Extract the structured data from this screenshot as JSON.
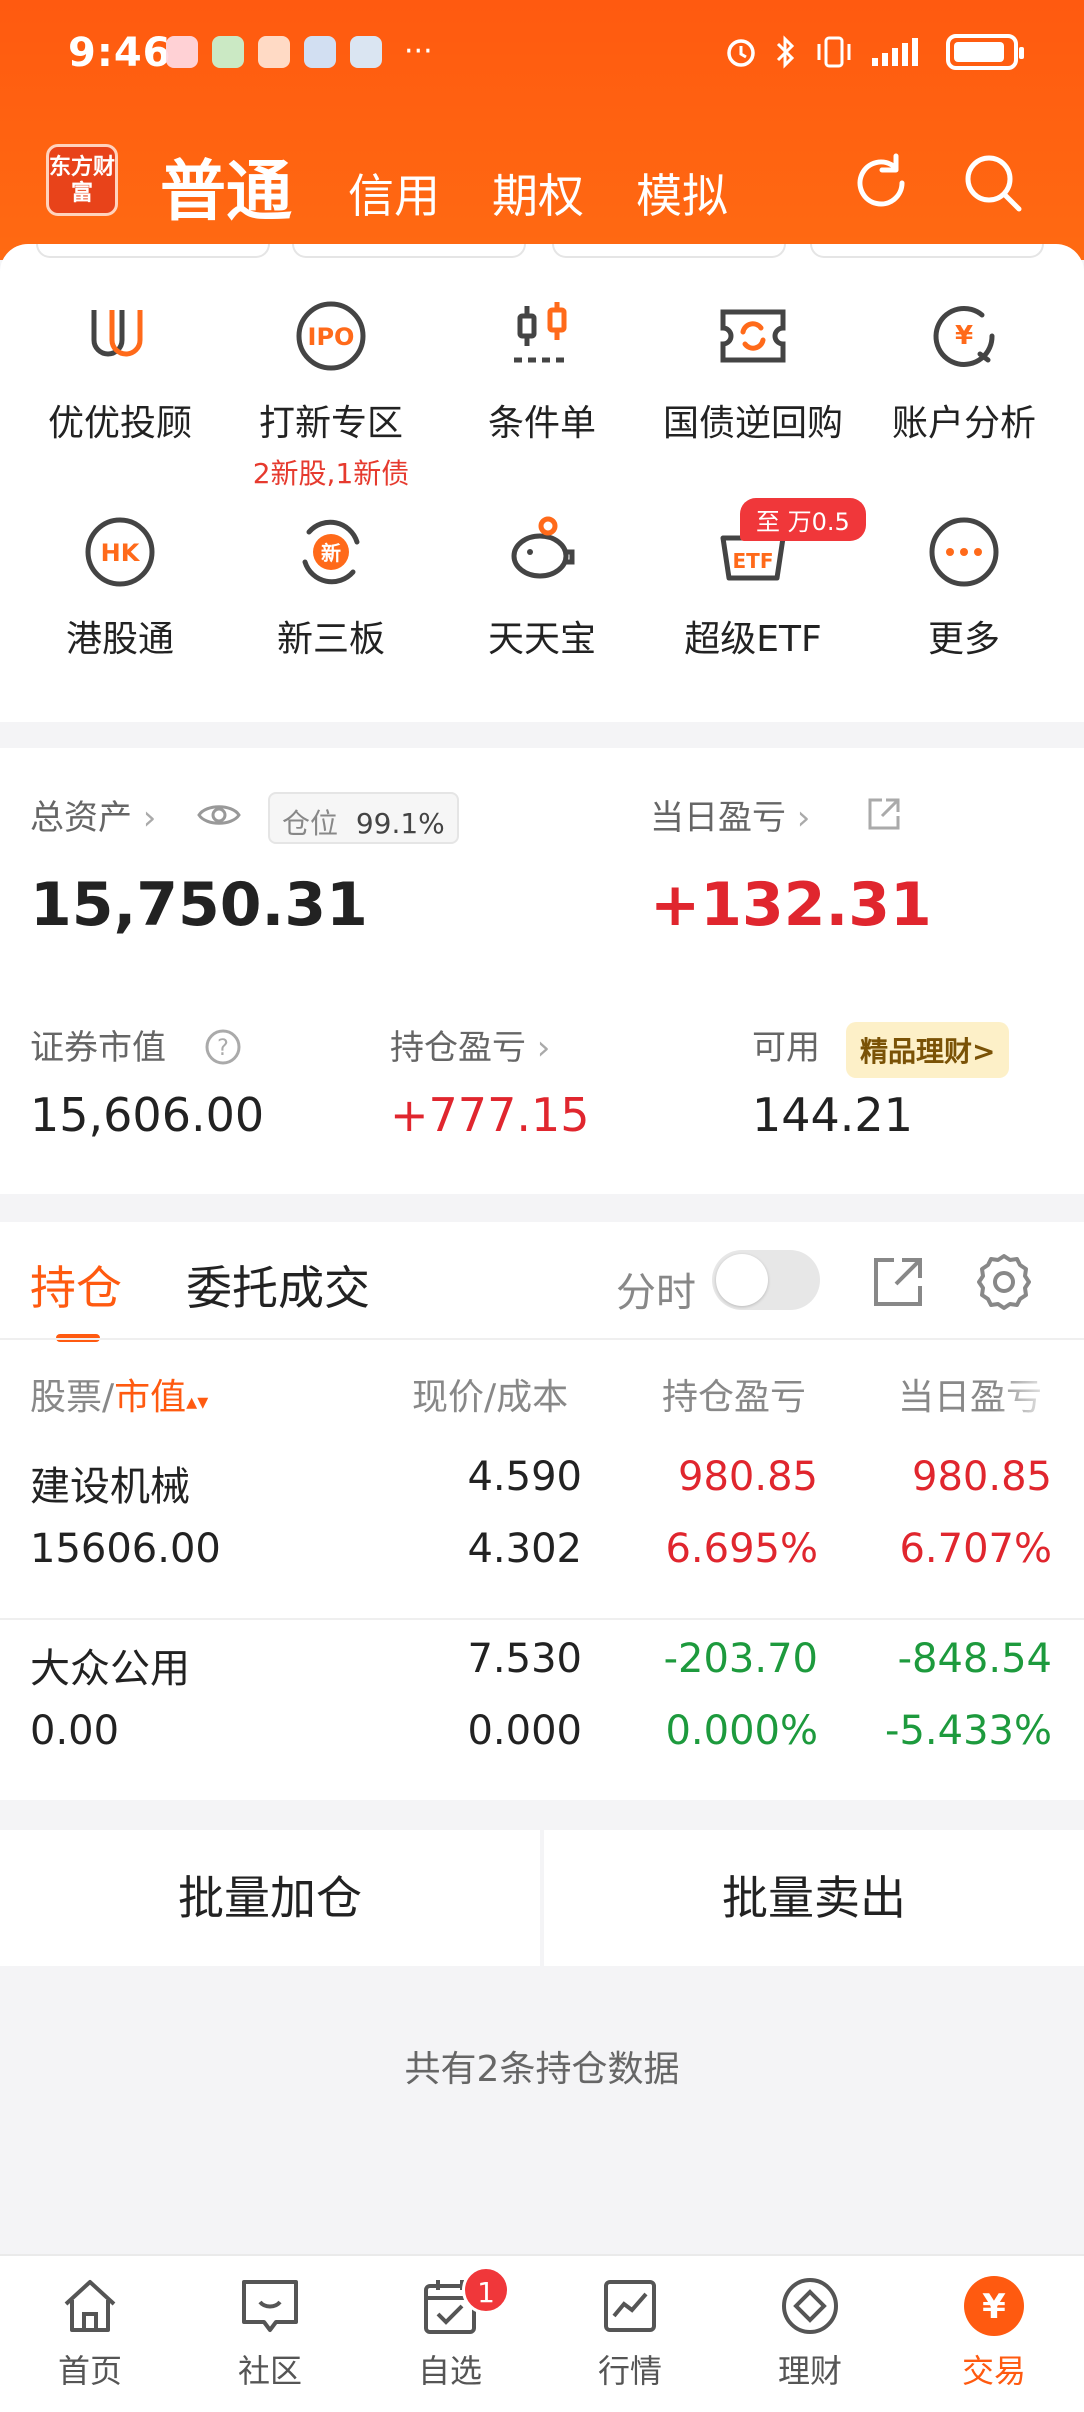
{
  "status_bar": {
    "time": "9:46"
  },
  "header": {
    "logo_text": "东方财富",
    "tabs": [
      "普通",
      "信用",
      "期权",
      "模拟"
    ]
  },
  "grid": {
    "items": [
      {
        "label": "优优投顾",
        "icon": "uu-advisor-icon"
      },
      {
        "label": "打新专区",
        "sub": "2新股,1新债",
        "icon": "ipo-icon"
      },
      {
        "label": "条件单",
        "icon": "condition-order-icon"
      },
      {
        "label": "国债逆回购",
        "icon": "reverse-repo-icon"
      },
      {
        "label": "账户分析",
        "icon": "account-analysis-icon"
      },
      {
        "label": "港股通",
        "icon": "hk-icon"
      },
      {
        "label": "新三板",
        "icon": "neeq-icon"
      },
      {
        "label": "天天宝",
        "icon": "piggy-bank-icon"
      },
      {
        "label": "超级ETF",
        "icon": "etf-icon"
      },
      {
        "label": "更多",
        "icon": "more-icon"
      }
    ],
    "promo_badge": "至 万0.5"
  },
  "assets": {
    "total_label": "总资产",
    "position_label": "仓位",
    "position_value": "99.1%",
    "total_value": "15,750.31",
    "daily_pl_label": "当日盈亏",
    "daily_pl_value": "+132.31",
    "market_value_label": "证券市值",
    "market_value": "15,606.00",
    "holding_pl_label": "持仓盈亏",
    "holding_pl_value": "+777.15",
    "available_label": "可用",
    "available_value": "144.21",
    "wealth_badge": "精品理财>"
  },
  "holdings": {
    "tab_positions": "持仓",
    "tab_orders": "委托成交",
    "fenshi_label": "分时",
    "headers": {
      "stock": "股票/",
      "mv": "市值",
      "price_cost": "现价/成本",
      "holding_pl": "持仓盈亏",
      "daily_pl": "当日盈亏"
    },
    "rows": [
      {
        "name": "建设机械",
        "market_value": "15606.00",
        "price": "4.590",
        "cost": "4.302",
        "holding_pl": "980.85",
        "holding_pct": "6.695%",
        "daily_pl": "980.85",
        "daily_pct": "6.707%"
      },
      {
        "name": "大众公用",
        "market_value": "0.00",
        "price": "7.530",
        "cost": "0.000",
        "holding_pl": "-203.70",
        "holding_pct": "0.000%",
        "daily_pl": "-848.54",
        "daily_pct": "-5.433%"
      }
    ],
    "batch_add": "批量加仓",
    "batch_sell": "批量卖出",
    "footer": "共有2条持仓数据"
  },
  "bottom_nav": {
    "items": [
      "首页",
      "社区",
      "自选",
      "行情",
      "理财",
      "交易"
    ],
    "watchlist_badge": "1",
    "trade_icon_text": "¥"
  },
  "colors": {
    "brand": "#ff5a10",
    "up": "#e0262e",
    "down": "#1d9a3d"
  }
}
